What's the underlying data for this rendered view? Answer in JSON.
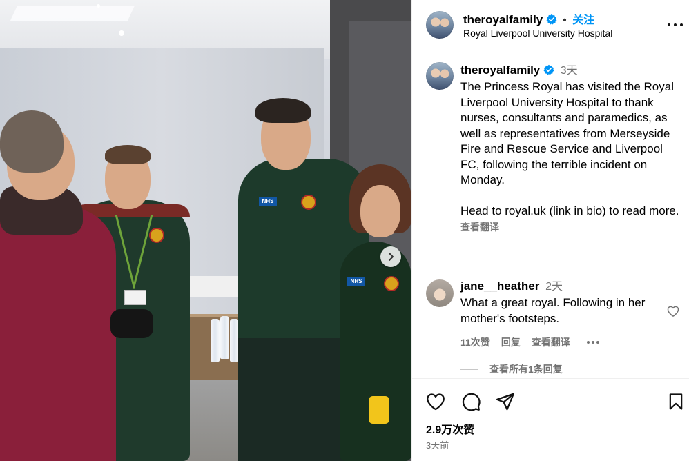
{
  "post": {
    "author": "theroyalfamily",
    "follow_label": "关注",
    "location": "Royal Liverpool University Hospital"
  },
  "caption": {
    "author": "theroyalfamily",
    "time": "3天",
    "text": "The Princess Royal has visited the Royal Liverpool University Hospital to thank nurses, consultants and paramedics, as well as representatives from Merseyside Fire and Rescue Service and Liverpool FC, following the terrible incident on Monday.\n\nHead to royal.uk (link in bio) to read more.",
    "see_translation": "查看翻译"
  },
  "comment": {
    "author": "jane__heather",
    "time": "2天",
    "text": "What a great royal. Following in her mother's footsteps.",
    "likes": "11次赞",
    "reply_label": "回复",
    "see_translation": "查看翻译",
    "view_replies": "查看所有1条回复"
  },
  "footer": {
    "likes": "2.9万次赞",
    "time": "3天前"
  },
  "photo": {
    "patch_text": "NHS"
  },
  "colors": {
    "accent": "#0095f6",
    "muted": "#737373",
    "verified": "#0095f6"
  },
  "icons": [
    "verified-badge-icon",
    "more-icon",
    "heart-icon",
    "comment-icon",
    "share-icon",
    "bookmark-icon",
    "chevron-right-icon"
  ]
}
